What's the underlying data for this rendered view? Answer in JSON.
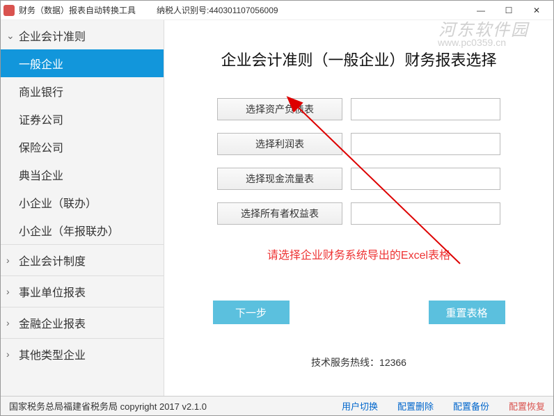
{
  "titlebar": {
    "title": "财务（数据）报表自动转换工具",
    "taxid_label": "纳税人识别号:440301107056009"
  },
  "watermark": {
    "text": "河东软件园",
    "url": "www.pc0359.cn"
  },
  "sidebar": {
    "section_rules": "企业会计准则",
    "items": [
      "一般企业",
      "商业银行",
      "证券公司",
      "保险公司",
      "典当企业",
      "小企业（联办）",
      "小企业（年报联办）"
    ],
    "sections": [
      "企业会计制度",
      "事业单位报表",
      "金融企业报表",
      "其他类型企业"
    ]
  },
  "content": {
    "title": "企业会计准则（一般企业）财务报表选择",
    "selectors": [
      "选择资产负债表",
      "选择利润表",
      "选择现金流量表",
      "选择所有者权益表"
    ],
    "hint": "请选择企业财务系统导出的Excel表格",
    "next_btn": "下一步",
    "reset_btn": "重置表格",
    "hotline": "技术服务热线：12366"
  },
  "footer": {
    "copyright": "国家税务总局福建省税务局  copyright 2017  v2.1.0",
    "links": [
      "用户切换",
      "配置删除",
      "配置备份",
      "配置恢复"
    ]
  }
}
